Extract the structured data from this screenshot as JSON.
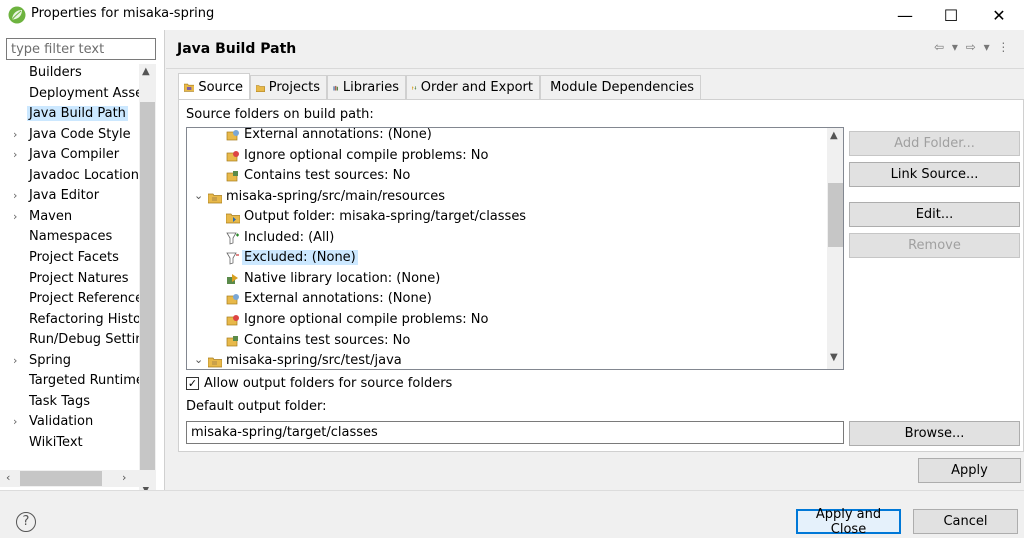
{
  "window": {
    "title": "Properties for misaka-spring",
    "minimize": "—",
    "maximize": "☐",
    "close": "✕"
  },
  "left_nav": {
    "filter_placeholder": "type filter text",
    "items": [
      {
        "label": "Builders",
        "expandable": false,
        "selected": false
      },
      {
        "label": "Deployment Asser",
        "expandable": false,
        "selected": false
      },
      {
        "label": "Java Build Path",
        "expandable": false,
        "selected": true
      },
      {
        "label": "Java Code Style",
        "expandable": true,
        "selected": false
      },
      {
        "label": "Java Compiler",
        "expandable": true,
        "selected": false
      },
      {
        "label": "Javadoc Location",
        "expandable": false,
        "selected": false
      },
      {
        "label": "Java Editor",
        "expandable": true,
        "selected": false
      },
      {
        "label": "Maven",
        "expandable": true,
        "selected": false
      },
      {
        "label": "Namespaces",
        "expandable": false,
        "selected": false
      },
      {
        "label": "Project Facets",
        "expandable": false,
        "selected": false
      },
      {
        "label": "Project Natures",
        "expandable": false,
        "selected": false
      },
      {
        "label": "Project References",
        "expandable": false,
        "selected": false
      },
      {
        "label": "Refactoring Histor",
        "expandable": false,
        "selected": false
      },
      {
        "label": "Run/Debug Settin",
        "expandable": false,
        "selected": false
      },
      {
        "label": "Spring",
        "expandable": true,
        "selected": false
      },
      {
        "label": "Targeted Runtime",
        "expandable": false,
        "selected": false
      },
      {
        "label": "Task Tags",
        "expandable": false,
        "selected": false
      },
      {
        "label": "Validation",
        "expandable": true,
        "selected": false
      },
      {
        "label": "WikiText",
        "expandable": false,
        "selected": false
      }
    ]
  },
  "page": {
    "title": "Java Build Path",
    "nav_arrows": "⇦ ▾ ⇨ ▾ ⋮"
  },
  "tabs": [
    {
      "label": "Source",
      "icon": "source-folder-icon",
      "active": true
    },
    {
      "label": "Projects",
      "icon": "projects-icon",
      "active": false
    },
    {
      "label": "Libraries",
      "icon": "libraries-icon",
      "active": false
    },
    {
      "label": "Order and Export",
      "icon": "order-export-icon",
      "active": false
    },
    {
      "label": "Module Dependencies",
      "icon": "module-dependencies-icon",
      "active": false
    }
  ],
  "source_tab": {
    "section_label": "Source folders on build path:",
    "tree": [
      {
        "label": "External annotations: (None)",
        "icon": "annotations-icon",
        "level": 1
      },
      {
        "label": "Ignore optional compile problems: No",
        "icon": "ignore-problems-icon",
        "level": 1
      },
      {
        "label": "Contains test sources: No",
        "icon": "test-sources-icon",
        "level": 1
      },
      {
        "label": "misaka-spring/src/main/resources",
        "icon": "package-folder-icon",
        "level": 0,
        "expanded": true
      },
      {
        "label": "Output folder: misaka-spring/target/classes",
        "icon": "output-folder-icon",
        "level": 1
      },
      {
        "label": "Included: (All)",
        "icon": "filter-include-icon",
        "level": 1
      },
      {
        "label": "Excluded: (None)",
        "icon": "filter-exclude-icon",
        "level": 1,
        "selected": true
      },
      {
        "label": "Native library location: (None)",
        "icon": "native-library-icon",
        "level": 1
      },
      {
        "label": "External annotations: (None)",
        "icon": "annotations-icon",
        "level": 1
      },
      {
        "label": "Ignore optional compile problems: No",
        "icon": "ignore-problems-icon",
        "level": 1
      },
      {
        "label": "Contains test sources: No",
        "icon": "test-sources-icon",
        "level": 1
      },
      {
        "label": "misaka-spring/src/test/java",
        "icon": "package-folder-icon",
        "level": 0,
        "expanded": true
      }
    ],
    "buttons": {
      "add_folder": "Add Folder...",
      "link_source": "Link Source...",
      "edit": "Edit...",
      "remove": "Remove"
    },
    "allow_output_label": "Allow output folders for source folders",
    "allow_output_checked": true,
    "default_output_label": "Default output folder:",
    "default_output_value": "misaka-spring/target/classes",
    "browse": "Browse..."
  },
  "apply_label": "Apply",
  "footer": {
    "help": "?",
    "apply_and_close": "Apply and Close",
    "cancel": "Cancel"
  },
  "colors": {
    "selection": "#cce8ff",
    "default_button_border": "#0078d7",
    "app_icon_green": "#4caf50"
  }
}
